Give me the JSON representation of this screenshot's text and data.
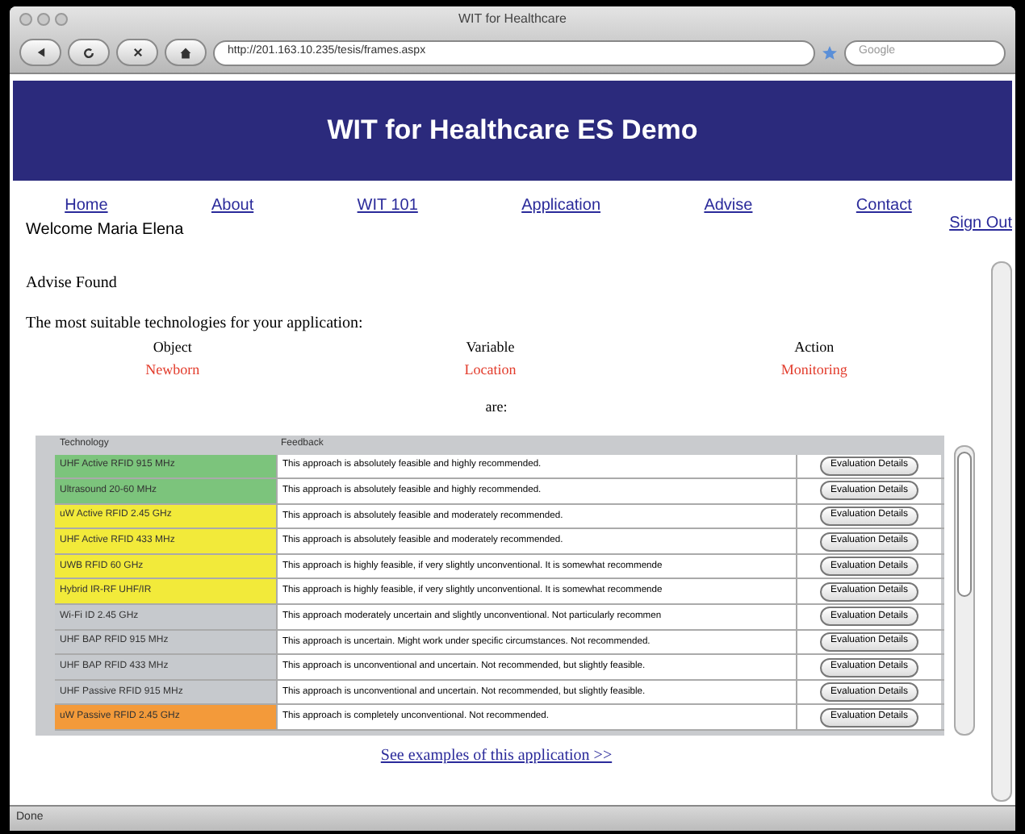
{
  "window": {
    "title": "WIT for Healthcare"
  },
  "toolbar": {
    "url": "http://201.163.10.235/tesis/frames.aspx",
    "search_placeholder": "Google"
  },
  "banner": {
    "title": "WIT for Healthcare ES Demo"
  },
  "nav": [
    "Home",
    "About",
    "WIT 101",
    "Application",
    "Advise",
    "Contact"
  ],
  "welcome": "Welcome Maria Elena",
  "sign_out": "Sign Out",
  "heading": "Advise Found",
  "intro": "The most suitable technologies for your application:",
  "criteria": [
    {
      "label": "Object",
      "value": "Newborn"
    },
    {
      "label": "Variable",
      "value": "Location"
    },
    {
      "label": "Action",
      "value": "Monitoring"
    }
  ],
  "are": "are:",
  "table": {
    "columns": [
      "Technology",
      "Feedback"
    ],
    "rows": [
      {
        "technology": "UHF Active RFID 915 MHz",
        "color": "#7cc47c",
        "feedback": "This approach is absolutely feasible and highly recommended.",
        "button": "Evaluation Details"
      },
      {
        "technology": "Ultrasound 20-60 MHz",
        "color": "#7cc47c",
        "feedback": "This approach is absolutely feasible and highly recommended.",
        "button": "Evaluation Details"
      },
      {
        "technology": "uW Active RFID 2.45 GHz",
        "color": "#f2ea3a",
        "feedback": "This approach is absolutely feasible and moderately recommended.",
        "button": "Evaluation Details"
      },
      {
        "technology": "UHF Active RFID 433 MHz",
        "color": "#f2ea3a",
        "feedback": "This approach is absolutely feasible and moderately recommended.",
        "button": "Evaluation Details"
      },
      {
        "technology": "UWB RFID 60 GHz",
        "color": "#f2ea3a",
        "feedback": "This approach is highly feasible, if very slightly unconventional. It is somewhat recommende",
        "button": "Evaluation Details"
      },
      {
        "technology": "Hybrid IR-RF UHF/IR",
        "color": "#f2ea3a",
        "feedback": "This approach is highly feasible, if very slightly unconventional. It is somewhat recommende",
        "button": "Evaluation Details"
      },
      {
        "technology": "Wi-Fi ID 2.45 GHz",
        "color": "#c6c9cd",
        "feedback": "This approach moderately uncertain and slightly unconventional. Not particularly recommen",
        "button": "Evaluation Details"
      },
      {
        "technology": "UHF BAP RFID 915 MHz",
        "color": "#c6c9cd",
        "feedback": "This approach is uncertain. Might work under specific circumstances. Not recommended.",
        "button": "Evaluation Details"
      },
      {
        "technology": "UHF BAP RFID 433 MHz",
        "color": "#c6c9cd",
        "feedback": "This approach is unconventional and uncertain. Not recommended, but slightly feasible.",
        "button": "Evaluation Details"
      },
      {
        "technology": "UHF Passive RFID 915 MHz",
        "color": "#c6c9cd",
        "feedback": "This approach is unconventional and uncertain. Not recommended, but slightly feasible.",
        "button": "Evaluation Details"
      },
      {
        "technology": "uW Passive RFID 2.45 GHz",
        "color": "#f39a3a",
        "feedback": "This approach is completely unconventional. Not recommended.",
        "button": "Evaluation Details"
      }
    ]
  },
  "examples_link": "See examples of this application >>",
  "status_bar": "Done"
}
